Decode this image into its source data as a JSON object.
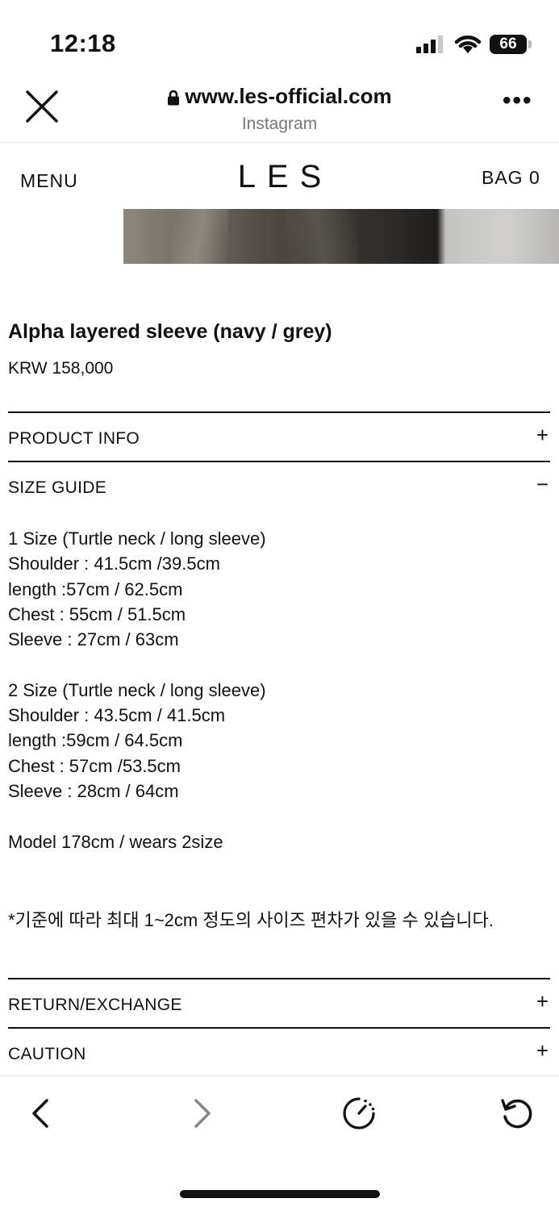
{
  "status_bar": {
    "time": "12:18",
    "battery": "66"
  },
  "browser": {
    "url": "www.les-official.com",
    "source": "Instagram"
  },
  "site_nav": {
    "menu_label": "MENU",
    "logo": "LES",
    "bag_label": "BAG  0"
  },
  "product": {
    "title": "Alpha layered sleeve (navy / grey)",
    "price": "KRW 158,000"
  },
  "accordion": {
    "product_info": {
      "label": "PRODUCT INFO",
      "icon": "+"
    },
    "size_guide": {
      "label": "SIZE GUIDE",
      "icon": "−"
    },
    "return_exchange": {
      "label": "RETURN/EXCHANGE",
      "icon": "+"
    },
    "caution": {
      "label": "CAUTION",
      "icon": "+"
    }
  },
  "size_guide": {
    "size1": [
      "1 Size (Turtle neck / long sleeve)",
      "Shoulder : 41.5cm /39.5cm",
      "length :57cm / 62.5cm",
      "Chest : 55cm / 51.5cm",
      "Sleeve : 27cm / 63cm"
    ],
    "size2": [
      "2 Size (Turtle neck / long sleeve)",
      "Shoulder : 43.5cm / 41.5cm",
      "length :59cm / 64.5cm",
      "Chest : 57cm /53.5cm",
      "Sleeve : 28cm / 64cm"
    ],
    "model": "Model 178cm / wears 2size",
    "note": "*기준에 따라 최대 1~2cm 정도의 사이즈 편차가 있을 수 있습니다."
  },
  "toolbar": {
    "icons": [
      "back-arrow-icon",
      "forward-arrow-icon",
      "timer-icon",
      "reload-icon"
    ]
  }
}
